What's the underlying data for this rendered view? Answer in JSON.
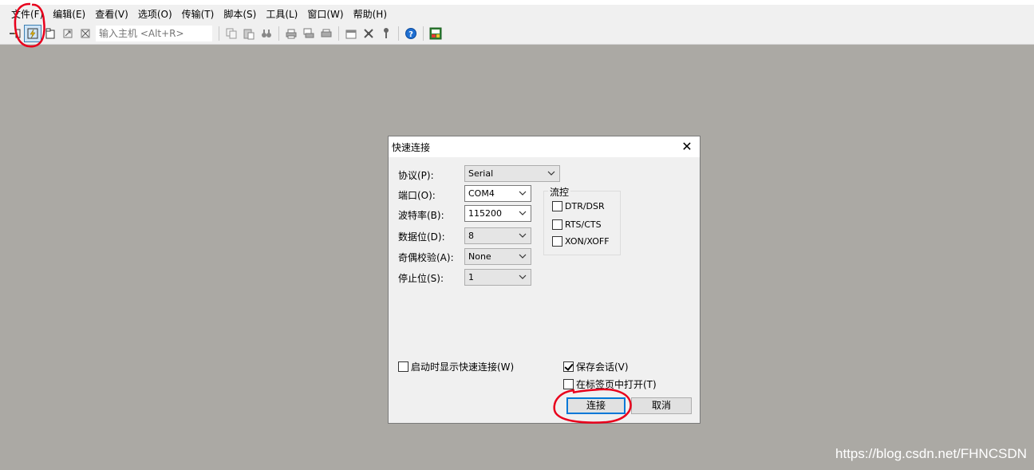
{
  "menubar": {
    "items": [
      "文件(F)",
      "编辑(E)",
      "查看(V)",
      "选项(O)",
      "传输(T)",
      "脚本(S)",
      "工具(L)",
      "窗口(W)",
      "帮助(H)"
    ]
  },
  "toolbar": {
    "host_placeholder": "输入主机 <Alt+R>",
    "icons": [
      "connect-icon",
      "quick-connect-icon",
      "connect-in-tab-icon",
      "reconnect-icon",
      "disconnect-icon",
      "copy-icon",
      "paste-icon",
      "find-icon",
      "print-icon",
      "print-setup-icon",
      "print-screen-icon",
      "session-options-icon",
      "global-options-icon",
      "keymap-icon",
      "help-icon",
      "sftp-icon"
    ]
  },
  "dialog": {
    "title": "快速连接",
    "close_glyph": "✕",
    "protocol": {
      "label": "协议(P):",
      "value": "Serial"
    },
    "port": {
      "label": "端口(O):",
      "value": "COM4"
    },
    "baud": {
      "label": "波特率(B):",
      "value": "115200"
    },
    "data_bits": {
      "label": "数据位(D):",
      "value": "8"
    },
    "parity": {
      "label": "奇偶校验(A):",
      "value": "None"
    },
    "stop_bits": {
      "label": "停止位(S):",
      "value": "1"
    },
    "flow_control": {
      "title": "流控",
      "options": [
        {
          "label": "DTR/DSR",
          "checked": false
        },
        {
          "label": "RTS/CTS",
          "checked": false
        },
        {
          "label": "XON/XOFF",
          "checked": false
        }
      ]
    },
    "show_on_startup": {
      "label": "启动时显示快速连接(W)",
      "checked": false
    },
    "save_session": {
      "label": "保存会话(V)",
      "checked": true
    },
    "open_in_tab": {
      "label": "在标签页中打开(T)",
      "checked": false
    },
    "connect_label": "连接",
    "cancel_label": "取消"
  },
  "watermark": "https://blog.csdn.net/FHNCSDN",
  "colors": {
    "workspace": "#aba9a4",
    "annotation": "#e8001c",
    "focus": "#0078d7"
  }
}
